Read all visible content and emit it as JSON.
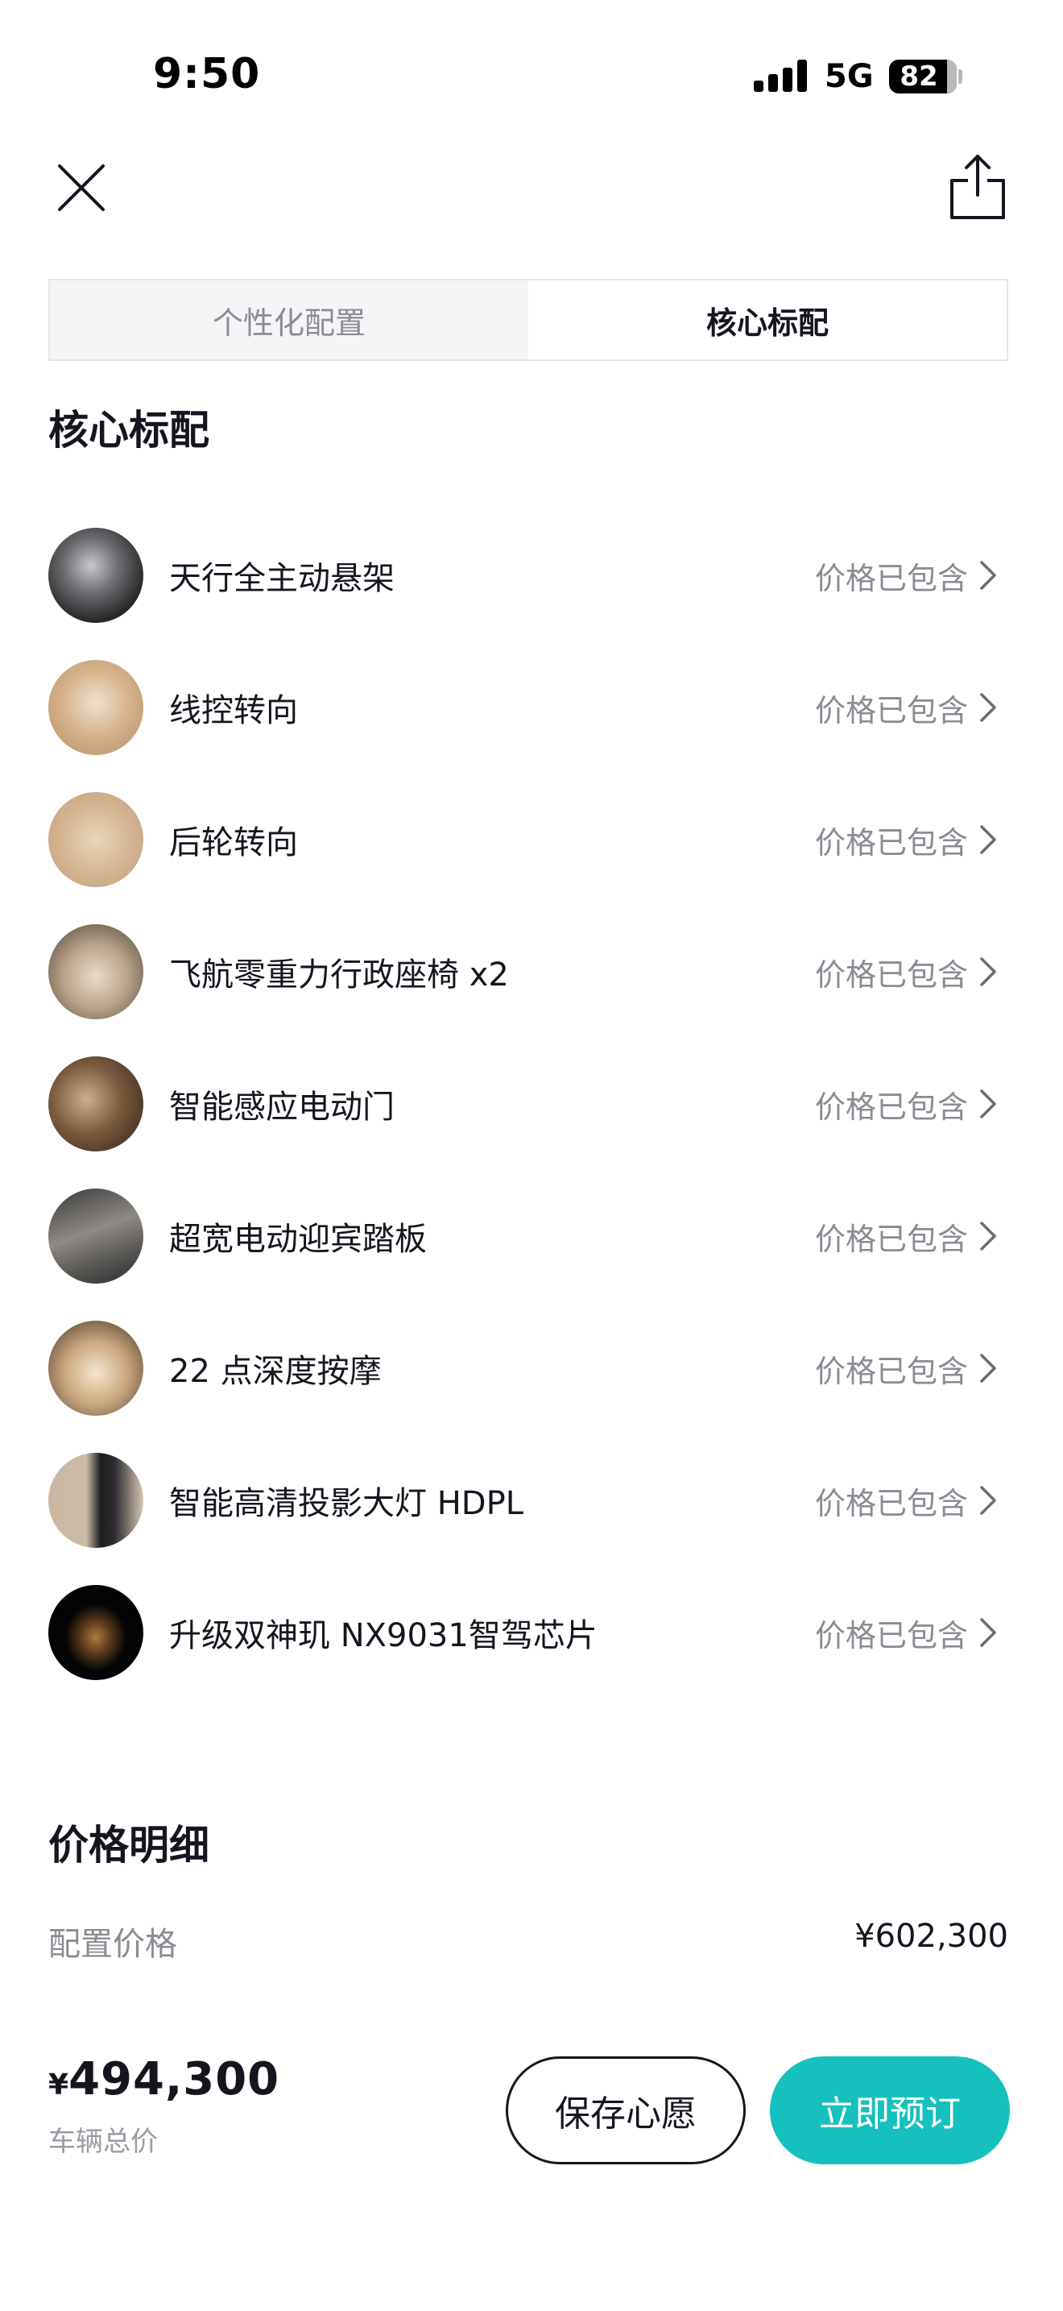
{
  "status_bar": {
    "time": "9:50",
    "network": "5G",
    "battery": "82"
  },
  "tabs": [
    {
      "label": "个性化配置",
      "active": false
    },
    {
      "label": "核心标配",
      "active": true
    }
  ],
  "core_section": {
    "title": "核心标配",
    "items": [
      {
        "name": "天行全主动悬架",
        "status": "价格已包含"
      },
      {
        "name": "线控转向",
        "status": "价格已包含"
      },
      {
        "name": "后轮转向",
        "status": "价格已包含"
      },
      {
        "name": "飞航零重力行政座椅 x2",
        "status": "价格已包含"
      },
      {
        "name": "智能感应电动门",
        "status": "价格已包含"
      },
      {
        "name": "超宽电动迎宾踏板",
        "status": "价格已包含"
      },
      {
        "name": "22 点深度按摩",
        "status": "价格已包含"
      },
      {
        "name": "智能高清投影大灯 HDPL",
        "status": "价格已包含"
      },
      {
        "name": "升级双神玑 NX9031智驾芯片",
        "status": "价格已包含"
      }
    ]
  },
  "price_section": {
    "title": "价格明细",
    "config_price_label": "配置价格",
    "config_price_value": "¥602,300"
  },
  "footer": {
    "currency_symbol": "¥",
    "total_amount": "494,300",
    "total_label": "车辆总价",
    "save_label": "保存心愿",
    "order_label": "立即预订"
  },
  "colors": {
    "accent": "#15c0be",
    "text": "#15151f",
    "muted": "#8a8c93"
  }
}
